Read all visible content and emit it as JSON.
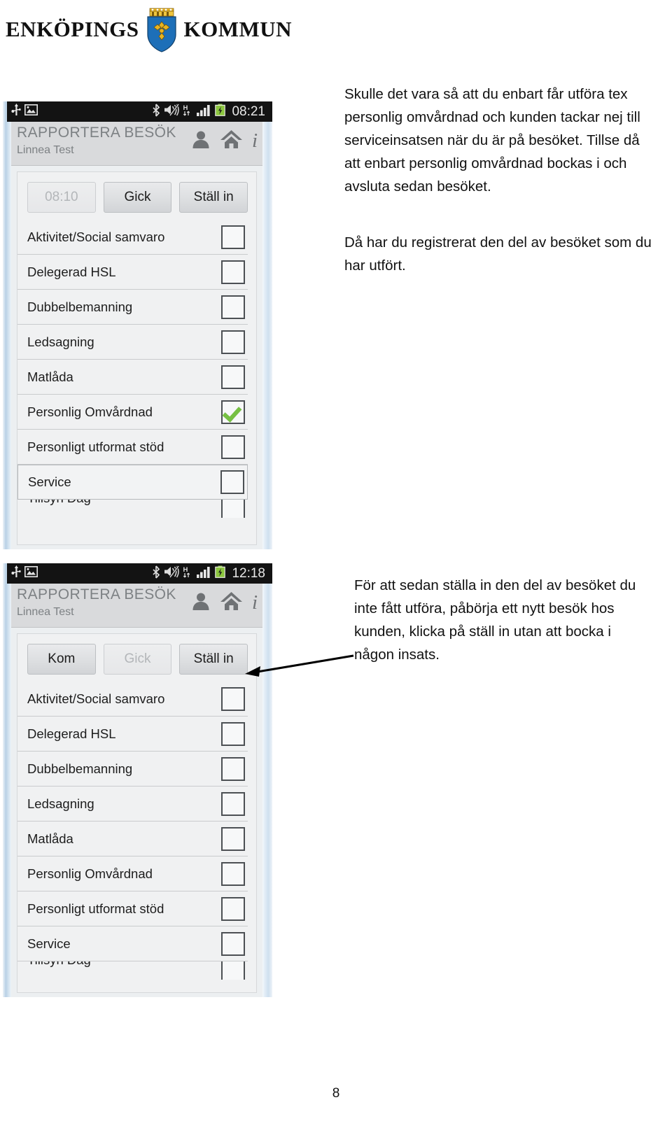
{
  "document": {
    "organization_name_left": "ENKÖPINGS",
    "organization_name_right": "KOMMUN",
    "crest_icon": "enkoping-coat-of-arms",
    "page_number": "8"
  },
  "text_blocks": {
    "paragraph_1": "Skulle det vara så att du enbart får utföra tex personlig omvårdnad och kunden tackar nej till serviceinsatsen när du är på besöket. Tillse då att enbart personlig omvårdnad bockas i och avsluta sedan besöket.",
    "paragraph_2": "Då har du registrerat den del av besöket som du har utfört.",
    "paragraph_3": "För att sedan ställa in den del av besöket du inte fått utföra, påbörja ett nytt besök hos kunden, klicka på ställ in utan att bocka i någon insats."
  },
  "screenshots": [
    {
      "id": "screenshot-top",
      "statusbar": {
        "clock": "08:21",
        "icons": [
          "usb-icon",
          "image-icon",
          "bluetooth-icon",
          "mute-icon",
          "hspa-network-icon",
          "signal-bars-icon",
          "battery-charging-icon"
        ]
      },
      "actionbar": {
        "title": "RAPPORTERA BESÖK",
        "subtitle": "Linnea Test",
        "icons": [
          "person-icon",
          "home-icon",
          "info-icon"
        ]
      },
      "buttons": [
        {
          "label": "08:10",
          "state": "disabled"
        },
        {
          "label": "Gick",
          "state": "enabled"
        },
        {
          "label": "Ställ in",
          "state": "enabled"
        }
      ],
      "list": [
        {
          "label": "Aktivitet/Social samvaro",
          "checked": false,
          "selected": false
        },
        {
          "label": "Delegerad HSL",
          "checked": false,
          "selected": false
        },
        {
          "label": "Dubbelbemanning",
          "checked": false,
          "selected": false
        },
        {
          "label": "Ledsagning",
          "checked": false,
          "selected": false
        },
        {
          "label": "Matlåda",
          "checked": false,
          "selected": false
        },
        {
          "label": "Personlig Omvårdnad",
          "checked": true,
          "selected": false
        },
        {
          "label": "Personligt utformat stöd",
          "checked": false,
          "selected": false
        },
        {
          "label": "Service",
          "checked": false,
          "selected": true
        },
        {
          "label": "Tillsyn Dag",
          "checked": false,
          "selected": false,
          "clipped": true
        }
      ]
    },
    {
      "id": "screenshot-bottom",
      "statusbar": {
        "clock": "12:18",
        "icons": [
          "usb-icon",
          "image-icon",
          "bluetooth-icon",
          "mute-icon",
          "hspa-network-icon",
          "signal-bars-icon",
          "battery-charging-icon"
        ]
      },
      "actionbar": {
        "title": "RAPPORTERA BESÖK",
        "subtitle": "Linnea Test",
        "icons": [
          "person-icon",
          "home-icon",
          "info-icon"
        ]
      },
      "buttons": [
        {
          "label": "Kom",
          "state": "enabled"
        },
        {
          "label": "Gick",
          "state": "disabled"
        },
        {
          "label": "Ställ in",
          "state": "enabled"
        }
      ],
      "list": [
        {
          "label": "Aktivitet/Social samvaro",
          "checked": false,
          "selected": false
        },
        {
          "label": "Delegerad HSL",
          "checked": false,
          "selected": false
        },
        {
          "label": "Dubbelbemanning",
          "checked": false,
          "selected": false
        },
        {
          "label": "Ledsagning",
          "checked": false,
          "selected": false
        },
        {
          "label": "Matlåda",
          "checked": false,
          "selected": false
        },
        {
          "label": "Personlig Omvårdnad",
          "checked": false,
          "selected": false
        },
        {
          "label": "Personligt utformat stöd",
          "checked": false,
          "selected": false
        },
        {
          "label": "Service",
          "checked": false,
          "selected": false
        },
        {
          "label": "Tillsyn Dag",
          "checked": false,
          "selected": false,
          "clipped": true
        }
      ]
    }
  ],
  "annotations": {
    "arrow_icon": "arrow-pointing-left",
    "arrow_target": "Ställ in"
  },
  "colors": {
    "checkmark_green": "#76c043",
    "statusbar_black": "#131313",
    "actionbar_grey": "#d9dadc",
    "crest_blue": "#1d6fb8",
    "crest_gold": "#e8b422"
  }
}
